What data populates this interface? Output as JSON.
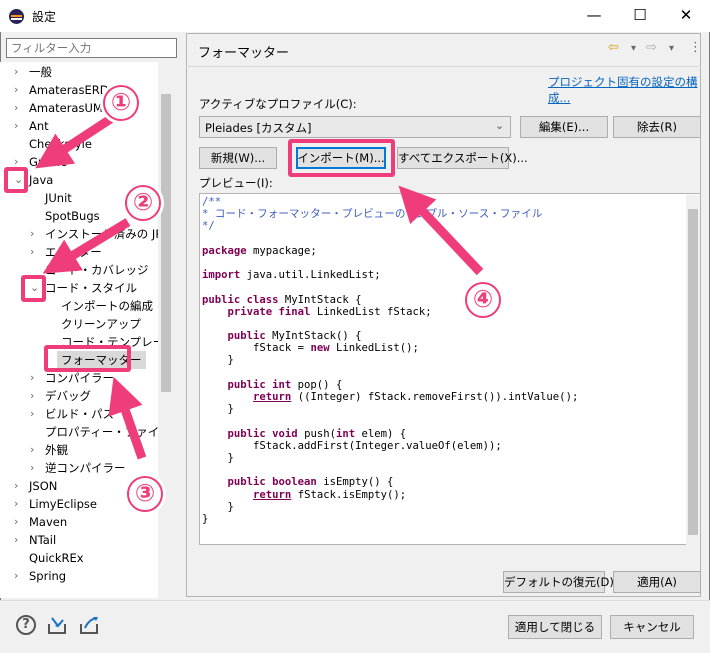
{
  "window": {
    "title": "設定",
    "controls": {
      "minimize": "—",
      "maximize": "☐",
      "close": "✕"
    }
  },
  "filter": {
    "placeholder": "フィルター入力"
  },
  "tree": {
    "items": [
      {
        "label": "一般",
        "expander": "›"
      },
      {
        "label": "AmaterasERD",
        "expander": "›"
      },
      {
        "label": "AmaterasUML",
        "expander": "›"
      },
      {
        "label": "Ant",
        "expander": "›"
      },
      {
        "label": "Checkstyle",
        "expander": ""
      },
      {
        "label": "Gradle",
        "expander": "›"
      },
      {
        "label": "Java",
        "expander": "⌄"
      },
      {
        "label": "JUnit",
        "expander": ""
      },
      {
        "label": "SpotBugs",
        "expander": ""
      },
      {
        "label": "インストール済みの JRE",
        "expander": "›"
      },
      {
        "label": "エディター",
        "expander": "›"
      },
      {
        "label": "コード・カバレッジ",
        "expander": ""
      },
      {
        "label": "コード・スタイル",
        "expander": "⌄"
      },
      {
        "label": "インポートの編成",
        "expander": ""
      },
      {
        "label": "クリーンアップ",
        "expander": ""
      },
      {
        "label": "コード・テンプレート",
        "expander": ""
      },
      {
        "label": "フォーマッター",
        "expander": ""
      },
      {
        "label": "コンパイラー",
        "expander": "›"
      },
      {
        "label": "デバッグ",
        "expander": "›"
      },
      {
        "label": "ビルド・パス",
        "expander": "›"
      },
      {
        "label": "プロパティー・ファイル・エディター",
        "expander": ""
      },
      {
        "label": "外観",
        "expander": "›"
      },
      {
        "label": "逆コンパイラー",
        "expander": "›"
      },
      {
        "label": "JSON",
        "expander": "›"
      },
      {
        "label": "LimyEclipse",
        "expander": "›"
      },
      {
        "label": "Maven",
        "expander": "›"
      },
      {
        "label": "NTail",
        "expander": "›"
      },
      {
        "label": "QuickREx",
        "expander": ""
      },
      {
        "label": "Spring",
        "expander": "›"
      }
    ]
  },
  "page": {
    "title": "フォーマッター",
    "nav": {
      "back": "⇦",
      "back_menu": "▾",
      "forward": "⇨",
      "forward_menu": "▾",
      "more": "⋮"
    },
    "project_link": "プロジェクト固有の設定の構成...",
    "active_profile_label": "アクティブなプロファイル(C):",
    "profile_value": "Pleiades [カスタム]",
    "combo_arrow": "⌄",
    "edit_button": "編集(E)...",
    "remove_button": "除去(R)",
    "new_button": "新規(W)...",
    "import_button": "インポート(M)...",
    "export_button": "すべてエクスポート(X)...",
    "preview_label": "プレビュー(I):",
    "code_lines": [
      [
        [
          "/**",
          "cm"
        ]
      ],
      [
        [
          "* コード・フォーマッター・プレビューのサンプル・ソース・ファイル",
          "cm"
        ]
      ],
      [
        [
          "*/",
          "cm"
        ]
      ],
      [],
      [
        [
          "package",
          "kw"
        ],
        [
          " mypackage;",
          ""
        ]
      ],
      [],
      [
        [
          "import",
          "kw"
        ],
        [
          " java.util.LinkedList;",
          ""
        ]
      ],
      [],
      [
        [
          "public class",
          "kw"
        ],
        [
          " MyIntStack {",
          ""
        ]
      ],
      [
        [
          "    ",
          ""
        ],
        [
          "private final",
          "kw"
        ],
        [
          " LinkedList fStack;",
          ""
        ]
      ],
      [],
      [
        [
          "    ",
          ""
        ],
        [
          "public",
          "kw"
        ],
        [
          " MyIntStack() {",
          ""
        ]
      ],
      [
        [
          "        fStack = ",
          ""
        ],
        [
          "new",
          "kw"
        ],
        [
          " LinkedList();",
          ""
        ]
      ],
      [
        [
          "    }",
          ""
        ]
      ],
      [],
      [
        [
          "    ",
          ""
        ],
        [
          "public int",
          "kw"
        ],
        [
          " pop() {",
          ""
        ]
      ],
      [
        [
          "        ",
          ""
        ],
        [
          "return",
          "kw ul"
        ],
        [
          " ((Integer) fStack.removeFirst()).intValue();",
          ""
        ]
      ],
      [
        [
          "    }",
          ""
        ]
      ],
      [],
      [
        [
          "    ",
          ""
        ],
        [
          "public void",
          "kw"
        ],
        [
          " push(",
          ""
        ],
        [
          "int",
          "kw"
        ],
        [
          " elem) {",
          ""
        ]
      ],
      [
        [
          "        fStack.addFirst(Integer.valueOf(elem));",
          ""
        ]
      ],
      [
        [
          "    }",
          ""
        ]
      ],
      [],
      [
        [
          "    ",
          ""
        ],
        [
          "public boolean",
          "kw"
        ],
        [
          " isEmpty() {",
          ""
        ]
      ],
      [
        [
          "        ",
          ""
        ],
        [
          "return",
          "kw ul"
        ],
        [
          " fStack.isEmpty();",
          ""
        ]
      ],
      [
        [
          "    }",
          ""
        ]
      ],
      [
        [
          "}",
          ""
        ]
      ]
    ],
    "restore_defaults_button": "デフォルトの復元(D)",
    "apply_button": "適用(A)"
  },
  "footer": {
    "help_icon": "?",
    "apply_close_button": "適用して閉じる",
    "cancel_button": "キャンセル"
  },
  "annotations": {
    "c1": "①",
    "c2": "②",
    "c3": "③",
    "c4": "④",
    "color": "#ee3d7a"
  }
}
